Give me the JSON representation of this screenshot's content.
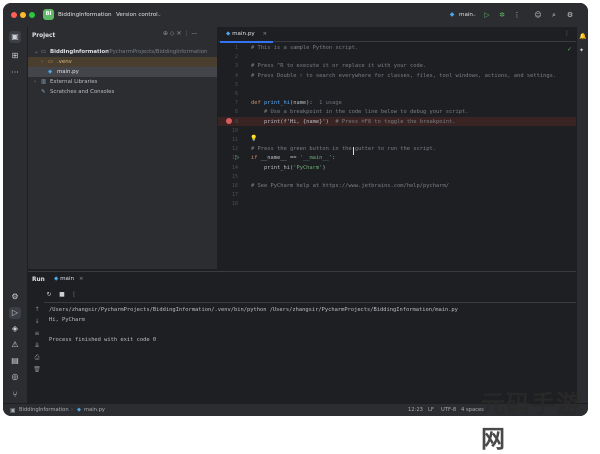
{
  "titlebar": {
    "project_badge": "BI",
    "project_name": "BiddingInformation",
    "vcs_label": "Version control",
    "run_config": "main",
    "icons": [
      "run-icon",
      "debug-icon",
      "more-icon",
      "profile-icon",
      "search-icon",
      "settings-icon"
    ]
  },
  "project_panel": {
    "title": "Project",
    "items": [
      {
        "label": "BiddingInformation",
        "detail": "~/PycharmProjects/BiddingInformation",
        "icon": "folder-icon"
      },
      {
        "label": ".venv",
        "detail": "",
        "icon": "folder-icon"
      },
      {
        "label": "main.py",
        "detail": "",
        "icon": "python-file-icon"
      },
      {
        "label": "External Libraries",
        "detail": "",
        "icon": "library-icon"
      },
      {
        "label": "Scratches and Consoles",
        "detail": "",
        "icon": "scratch-icon"
      }
    ]
  },
  "editor": {
    "tab_label": "main.py",
    "line_numbers": [
      "1",
      "2",
      "3",
      "4",
      "5",
      "6",
      "7",
      "8",
      "9",
      "10",
      "11",
      "12",
      "13",
      "14",
      "15",
      "16",
      "17",
      "18"
    ],
    "lines": [
      {
        "n": 1,
        "parts": [
          {
            "t": "# This is a sample Python script.",
            "c": "cmt"
          }
        ]
      },
      {
        "n": 3,
        "parts": [
          {
            "t": "# Press ^R to execute it or replace it with your code.",
            "c": "cmt"
          }
        ]
      },
      {
        "n": 4,
        "parts": [
          {
            "t": "# Press Double ⇧ to search everywhere for classes, files, tool windows, actions, and settings.",
            "c": "cmt"
          }
        ]
      },
      {
        "n": 7,
        "parts": [
          {
            "t": "def ",
            "c": "kw"
          },
          {
            "t": "print_hi",
            "c": "fn"
          },
          {
            "t": "(name):  ",
            "c": ""
          },
          {
            "t": "1 usage",
            "c": "hint"
          }
        ]
      },
      {
        "n": 8,
        "parts": [
          {
            "t": "    # Use a breakpoint in the code line below to debug your script.",
            "c": "cmt"
          }
        ]
      },
      {
        "n": 9,
        "parts": [
          {
            "t": "    print(f'Hi, {name}')  ",
            "c": ""
          },
          {
            "t": "# Press ⌘F8 to toggle the breakpoint.",
            "c": "cmt"
          }
        ]
      },
      {
        "n": 12,
        "parts": [
          {
            "t": "# Press the green button in the gutter to run the script.",
            "c": "cmt"
          }
        ]
      },
      {
        "n": 13,
        "parts": [
          {
            "t": "if ",
            "c": "kw"
          },
          {
            "t": "__name__ == ",
            "c": ""
          },
          {
            "t": "'__main__'",
            "c": "str"
          },
          {
            "t": ":",
            "c": ""
          }
        ]
      },
      {
        "n": 14,
        "parts": [
          {
            "t": "    print_hi(",
            "c": ""
          },
          {
            "t": "'PyCharm'",
            "c": "str"
          },
          {
            "t": ")",
            "c": ""
          }
        ]
      },
      {
        "n": 16,
        "parts": [
          {
            "t": "# See PyCharm help at https://www.jetbrains.com/help/pycharm/",
            "c": "cmt"
          }
        ]
      }
    ]
  },
  "run_panel": {
    "title": "Run",
    "tab_label": "main",
    "console": [
      "/Users/zhangsir/PycharmProjects/BiddingInformation/.venv/bin/python /Users/zhangsir/PycharmProjects/BiddingInformation/main.py",
      "Hi, PyCharm",
      "",
      "Process finished with exit code 0"
    ]
  },
  "statusbar": {
    "breadcrumb_project": "BiddingInformation",
    "breadcrumb_file": "main.py",
    "position": "12:23",
    "line_ending": "LF",
    "encoding": "UTF-8",
    "indent": "4 spaces"
  },
  "watermark": "元码手游网"
}
